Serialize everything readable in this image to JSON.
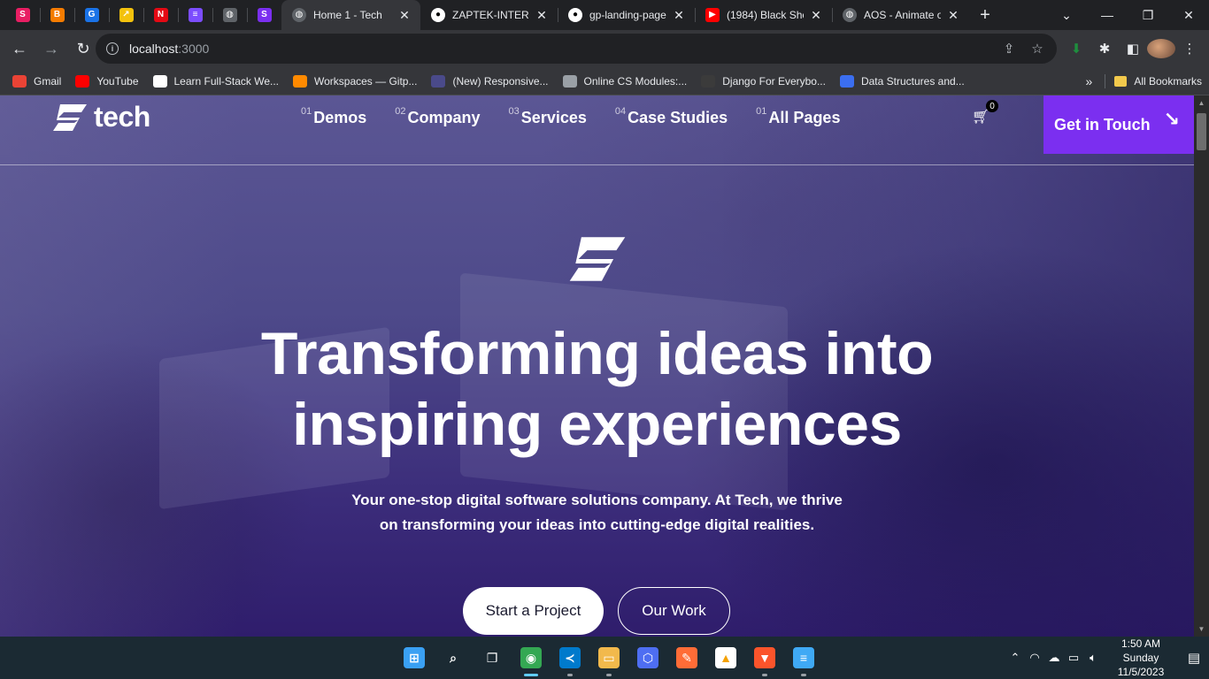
{
  "browser": {
    "pinned_tabs": [
      {
        "icon": "s-square-icon",
        "glyph": "S",
        "color": "#e91e63"
      },
      {
        "icon": "blogger-icon",
        "glyph": "B",
        "color": "#f57c00"
      },
      {
        "icon": "chrome-web-icon",
        "glyph": "G",
        "color": "#1a73e8"
      },
      {
        "icon": "arrow-square-icon",
        "glyph": "↗",
        "color": "#f4c20d"
      },
      {
        "icon": "netflix-icon",
        "glyph": "N",
        "color": "#e50914"
      },
      {
        "icon": "list-icon",
        "glyph": "≡",
        "color": "#7c4dff"
      },
      {
        "icon": "globe-icon",
        "glyph": "◍",
        "color": "#5f6368"
      },
      {
        "icon": "tech-logo-icon",
        "glyph": "S",
        "color": "#7b2ff0"
      }
    ],
    "tabs": [
      {
        "title": "Home 1 - Tech",
        "active": true,
        "icon": "globe-icon"
      },
      {
        "title": "ZAPTEK-INTERN",
        "active": false,
        "icon": "github-icon"
      },
      {
        "title": "gp-landing-page",
        "active": false,
        "icon": "github-icon"
      },
      {
        "title": "(1984) Black She",
        "active": false,
        "icon": "youtube-icon"
      },
      {
        "title": "AOS - Animate o",
        "active": false,
        "icon": "globe-icon"
      }
    ],
    "url_host": "localhost",
    "url_port": ":3000",
    "bookmarks": [
      {
        "label": "Gmail",
        "icon": "gmail-icon",
        "color": "#ea4335"
      },
      {
        "label": "YouTube",
        "icon": "youtube-icon",
        "color": "#ff0000"
      },
      {
        "label": "Learn Full-Stack We...",
        "icon": "x-icon",
        "color": "#ffffff"
      },
      {
        "label": "Workspaces — Gitp...",
        "icon": "gitpod-icon",
        "color": "#ff8a00"
      },
      {
        "label": "(New) Responsive...",
        "icon": "a-icon",
        "color": "#4a4a8a"
      },
      {
        "label": "Online CS Modules:...",
        "icon": "globe-icon",
        "color": "#9aa0a6"
      },
      {
        "label": "Django For Everybo...",
        "icon": "cc-icon",
        "color": "#3b3b3b"
      },
      {
        "label": "Data Structures and...",
        "icon": "doc-icon",
        "color": "#3b6ef0"
      }
    ],
    "all_bookmarks": "All Bookmarks"
  },
  "site": {
    "logo_text": "tech",
    "nav": [
      {
        "num": "01",
        "label": "Demos"
      },
      {
        "num": "02",
        "label": "Company"
      },
      {
        "num": "03",
        "label": "Services"
      },
      {
        "num": "04",
        "label": "Case Studies"
      },
      {
        "num": "01",
        "label": "All Pages"
      }
    ],
    "cart_count": "0",
    "cta": "Get in Touch",
    "headline_line1": "Transforming ideas into",
    "headline_line2": "inspiring experiences",
    "subtitle_line1": "Your one-stop digital software solutions company. At Tech, we thrive",
    "subtitle_line2": "on transforming your ideas into cutting-edge digital realities.",
    "btn_primary": "Start a Project",
    "btn_secondary": "Our Work",
    "accent": "#7b2ff0"
  },
  "taskbar": {
    "apps": [
      {
        "name": "windows-start-icon",
        "glyph": "⊞",
        "color": "#3aa0f3",
        "running": false
      },
      {
        "name": "search-icon",
        "glyph": "⌕",
        "color": "transparent",
        "running": false
      },
      {
        "name": "task-view-icon",
        "glyph": "❐",
        "color": "transparent",
        "running": false
      },
      {
        "name": "chrome-icon",
        "glyph": "◉",
        "color": "#34a853",
        "running": true
      },
      {
        "name": "vscode-icon",
        "glyph": "≺",
        "color": "#007acc",
        "running": false
      },
      {
        "name": "file-explorer-icon",
        "glyph": "▭",
        "color": "#f2b94c",
        "running": false
      },
      {
        "name": "copilot-icon",
        "glyph": "⬡",
        "color": "#4e6ef2",
        "running": false
      },
      {
        "name": "postman-icon",
        "glyph": "✎",
        "color": "#ff6c37",
        "running": false
      },
      {
        "name": "firebase-icon",
        "glyph": "▲",
        "color": "#ffffff",
        "running": false
      },
      {
        "name": "brave-icon",
        "glyph": "▼",
        "color": "#fb542b",
        "running": false
      },
      {
        "name": "notepad-icon",
        "glyph": "≡",
        "color": "#3fa9f5",
        "running": false
      }
    ],
    "time": "1:50 AM",
    "day": "Sunday",
    "date": "11/5/2023"
  }
}
